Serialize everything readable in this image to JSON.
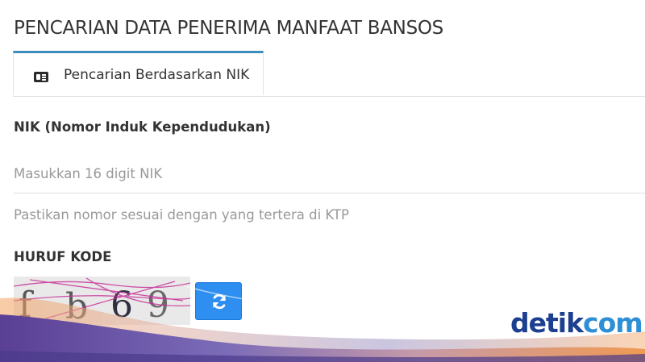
{
  "page": {
    "title": "PENCARIAN DATA PENERIMA MANFAAT BANSOS"
  },
  "tabs": [
    {
      "label": "Pencarian Berdasarkan NIK",
      "icon": "id-card-icon",
      "active": true
    }
  ],
  "form": {
    "nik": {
      "label": "NIK (Nomor Induk Kependudukan)",
      "value": "",
      "placeholder": "Masukkan 16 digit NIK",
      "help": "Pastikan nomor sesuai dengan yang tertera di KTP"
    },
    "captcha": {
      "label": "HURUF KODE",
      "code": "fb69",
      "refresh_icon": "refresh-icon"
    }
  },
  "brand": {
    "logo_primary": "detik",
    "logo_secondary": "com"
  },
  "colors": {
    "tab_accent": "#3c8dbc",
    "refresh_button": "#2e8ff0",
    "logo_primary": "#1d3f8f",
    "logo_secondary": "#2d8fd5",
    "band_purple": "#6a4fa0",
    "band_orange": "#f09a52"
  }
}
